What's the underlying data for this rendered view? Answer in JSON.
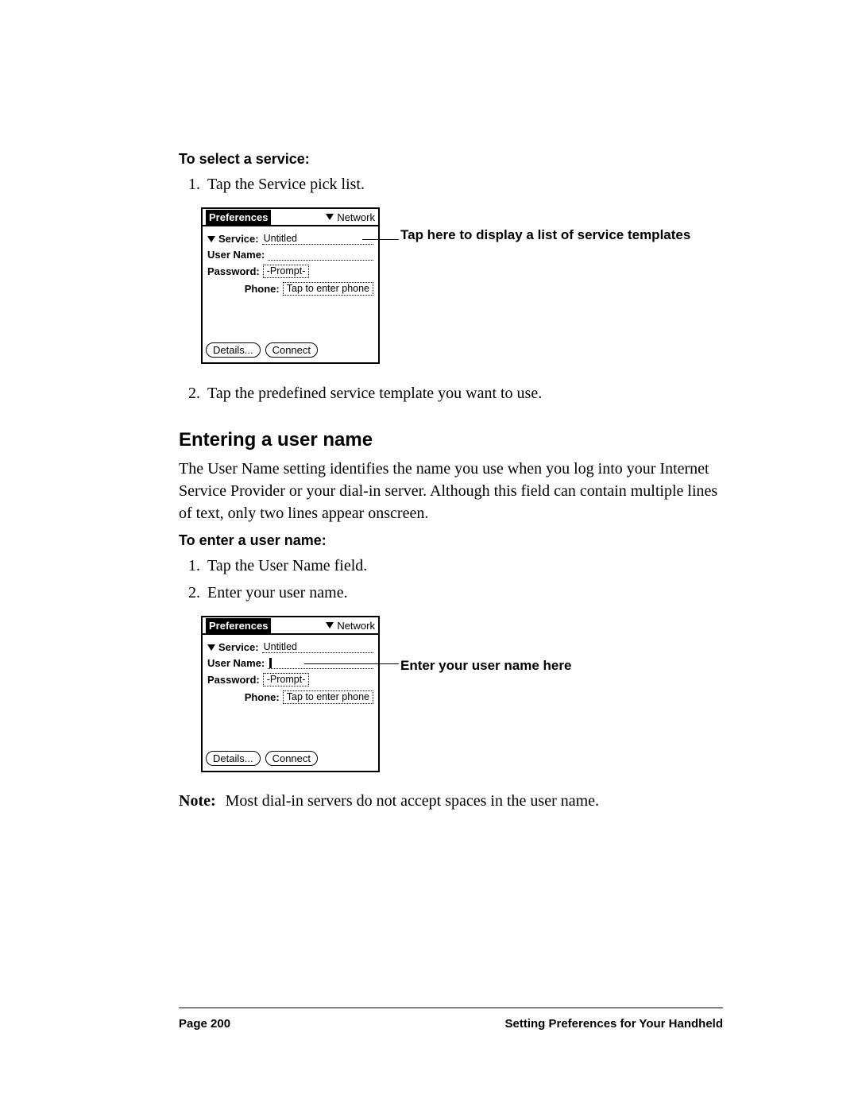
{
  "section1": {
    "heading": "To select a service:",
    "step1": "Tap the Service pick list.",
    "step2": "Tap the predefined service template you want to use."
  },
  "section2": {
    "heading": "Entering a user name",
    "para": "The User Name setting identifies the name you use when you log into your Internet Service Provider or your dial-in server. Although this field can contain multiple lines of text, only two lines appear onscreen.",
    "subheading": "To enter a user name:",
    "step1": "Tap the User Name field.",
    "step2": "Enter your user name."
  },
  "callouts": {
    "fig1": "Tap here to display a list of service templates",
    "fig2": "Enter your user name here"
  },
  "palm": {
    "title_left": "Preferences",
    "title_right": "Network",
    "service_label": "Service:",
    "service_value": "Untitled",
    "user_label": "User Name:",
    "password_label": "Password:",
    "password_value": "-Prompt-",
    "phone_label": "Phone:",
    "phone_value": "Tap to enter phone",
    "btn_details": "Details...",
    "btn_connect": "Connect"
  },
  "note": {
    "label": "Note:",
    "text": "Most dial-in servers do not accept spaces in the user name."
  },
  "footer": {
    "left": "Page 200",
    "right": "Setting Preferences for Your Handheld"
  }
}
